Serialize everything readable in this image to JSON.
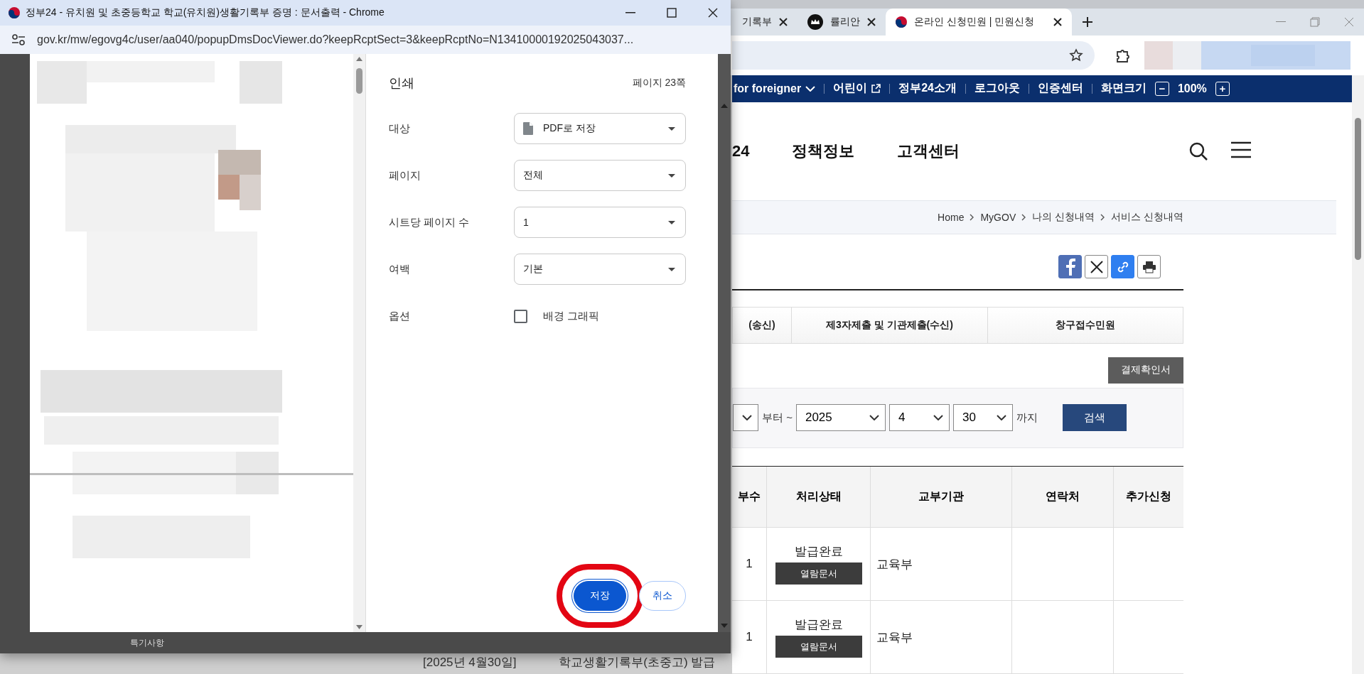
{
  "browser": {
    "tabs": [
      {
        "title": "기록부",
        "selected": false
      },
      {
        "title": "률리안",
        "selected": false
      },
      {
        "title": "온라인 신청민원 | 민원신청",
        "selected": true
      }
    ]
  },
  "site": {
    "top_links": [
      {
        "label": "for foreigner",
        "dropdown": true,
        "external": false
      },
      {
        "label": "어린이",
        "dropdown": false,
        "external": true
      },
      {
        "label": "정부24소개",
        "dropdown": false,
        "external": false
      },
      {
        "label": "로그아웃",
        "dropdown": false,
        "external": false
      },
      {
        "label": "인증센터",
        "dropdown": false,
        "external": false
      }
    ],
    "zoom": {
      "label": "화면크기",
      "minus": "−",
      "value": "100%",
      "plus": "+"
    },
    "menu": [
      "24",
      "정책정보",
      "고객센터"
    ],
    "breadcrumb": [
      "Home",
      "MyGOV",
      "나의 신청내역",
      "서비스 신청내역"
    ],
    "tabs": [
      {
        "label": "(송신)",
        "selected": false
      },
      {
        "label": "제3자제출 및 기관제출(수신)",
        "selected": false
      },
      {
        "label": "창구접수민원",
        "selected": false
      }
    ],
    "payment_button": "결제확인서",
    "search": {
      "from_suffix": "부터 ~",
      "year": "2025",
      "month": "4",
      "day": "30",
      "to_suffix": "까지",
      "button": "검색"
    },
    "table": {
      "columns": [
        "부수",
        "처리상태",
        "교부기관",
        "연락처",
        "추가신청"
      ],
      "rows": [
        {
          "copies": "1",
          "status": "발급완료",
          "action": "열람문서",
          "issuer": "교육부"
        },
        {
          "copies": "1",
          "status": "발급완료",
          "action": "열람문서",
          "issuer": "교육부"
        }
      ]
    },
    "behind": [
      "[2025년 4월30일]",
      "학교생활기록부(초중고) 발급"
    ]
  },
  "popup": {
    "title": "정부24 - 유치원 및 초중등학교 학교(유치원)생활기록부 증명 : 문서출력 - Chrome",
    "url": "gov.kr/mw/egovg4c/user/aa040/popupDmsDocViewer.do?keepRcptSect=3&keepRcptNo=N13410000192025043037...",
    "behind_label": "특기사항",
    "print": {
      "heading": "인쇄",
      "page_count": "페이지 23쪽",
      "settings": [
        {
          "kind": "destination",
          "label": "대상",
          "value": "PDF로 저장"
        },
        {
          "kind": "select",
          "label": "페이지",
          "value": "전체"
        },
        {
          "kind": "select",
          "label": "시트당 페이지 수",
          "value": "1"
        },
        {
          "kind": "select",
          "label": "여백",
          "value": "기본"
        },
        {
          "kind": "checkbox",
          "label": "옵션",
          "text": "배경 그래픽",
          "checked": false
        }
      ],
      "buttons": [
        {
          "label": "저장",
          "primary": true,
          "highlighted": true
        },
        {
          "label": "취소",
          "primary": false,
          "highlighted": false
        }
      ]
    }
  }
}
